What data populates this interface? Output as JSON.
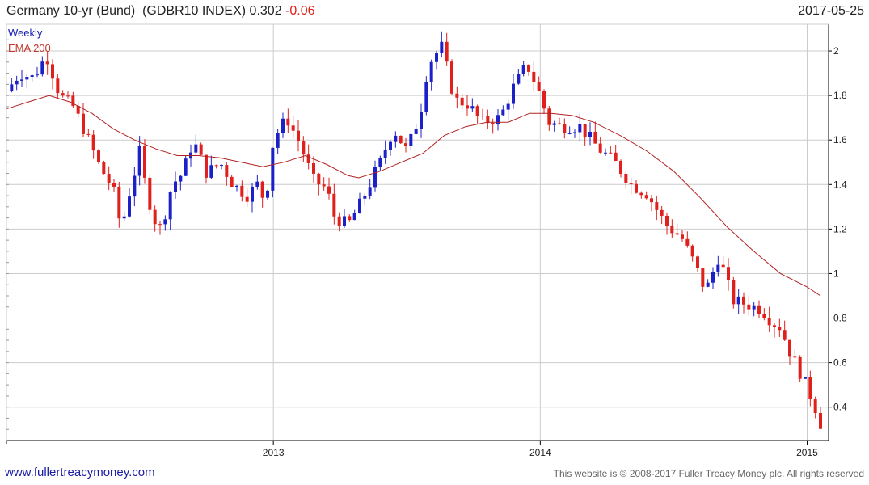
{
  "header": {
    "name": "Germany 10-yr (Bund)",
    "ticker": "(GDBR10 INDEX)",
    "last": "0.302",
    "change": "-0.06",
    "date": "2017-05-25"
  },
  "footer": {
    "site": "www.fullertreacymoney.com",
    "copyright": "This website is © 2008-2017 Fuller Treacy Money plc. All rights reserved"
  },
  "colors": {
    "up": "#1c20c8",
    "down": "#e0201c",
    "ema": "#b22222",
    "grid": "#cccccc",
    "axis": "#000000"
  },
  "chart_data": {
    "type": "candlestick",
    "legend": [
      "Weekly",
      "EMA 200"
    ],
    "legend_placement": "top-left",
    "y_axis_side": "right",
    "ylim": [
      0.25,
      2.12
    ],
    "yticks": [
      0.4,
      0.6,
      0.8,
      1,
      1.2,
      1.4,
      1.6,
      1.8,
      2
    ],
    "ytick_labels": [
      "0.4",
      "0.6",
      "0.8",
      "1",
      "1.2",
      "1.4",
      "1.6",
      "1.8",
      "2"
    ],
    "xlim": [
      2012.0,
      2015.05
    ],
    "xticks": [
      2013,
      2014,
      2015
    ],
    "xtick_labels": [
      "2013",
      "2014",
      "2015"
    ],
    "grid": true,
    "anchors": [
      [
        2012.0,
        1.82
      ],
      [
        2012.05,
        1.9
      ],
      [
        2012.1,
        1.88
      ],
      [
        2012.15,
        1.98
      ],
      [
        2012.2,
        1.8
      ],
      [
        2012.25,
        1.75
      ],
      [
        2012.3,
        1.62
      ],
      [
        2012.35,
        1.48
      ],
      [
        2012.4,
        1.38
      ],
      [
        2012.43,
        1.2
      ],
      [
        2012.46,
        1.36
      ],
      [
        2012.5,
        1.55
      ],
      [
        2012.52,
        1.4
      ],
      [
        2012.55,
        1.25
      ],
      [
        2012.58,
        1.2
      ],
      [
        2012.62,
        1.4
      ],
      [
        2012.66,
        1.45
      ],
      [
        2012.7,
        1.6
      ],
      [
        2012.75,
        1.45
      ],
      [
        2012.8,
        1.5
      ],
      [
        2012.85,
        1.4
      ],
      [
        2012.9,
        1.35
      ],
      [
        2012.94,
        1.4
      ],
      [
        2012.97,
        1.32
      ],
      [
        2013.0,
        1.6
      ],
      [
        2013.05,
        1.7
      ],
      [
        2013.1,
        1.58
      ],
      [
        2013.15,
        1.42
      ],
      [
        2013.2,
        1.38
      ],
      [
        2013.23,
        1.25
      ],
      [
        2013.28,
        1.22
      ],
      [
        2013.32,
        1.3
      ],
      [
        2013.36,
        1.4
      ],
      [
        2013.4,
        1.5
      ],
      [
        2013.45,
        1.65
      ],
      [
        2013.5,
        1.55
      ],
      [
        2013.55,
        1.72
      ],
      [
        2013.58,
        1.94
      ],
      [
        2013.63,
        2.02
      ],
      [
        2013.68,
        1.78
      ],
      [
        2013.73,
        1.76
      ],
      [
        2013.78,
        1.68
      ],
      [
        2013.85,
        1.7
      ],
      [
        2013.9,
        1.84
      ],
      [
        2013.95,
        1.94
      ],
      [
        2014.0,
        1.8
      ],
      [
        2014.03,
        1.68
      ],
      [
        2014.08,
        1.66
      ],
      [
        2014.15,
        1.66
      ],
      [
        2014.22,
        1.56
      ],
      [
        2014.28,
        1.5
      ],
      [
        2014.34,
        1.4
      ],
      [
        2014.4,
        1.36
      ],
      [
        2014.47,
        1.22
      ],
      [
        2014.53,
        1.16
      ],
      [
        2014.58,
        1.04
      ],
      [
        2014.62,
        0.92
      ],
      [
        2014.67,
        1.08
      ],
      [
        2014.72,
        0.88
      ],
      [
        2014.78,
        0.86
      ],
      [
        2014.83,
        0.84
      ],
      [
        2014.87,
        0.78
      ],
      [
        2014.9,
        0.76
      ],
      [
        2014.93,
        0.66
      ],
      [
        2014.98,
        0.54
      ],
      [
        2015.03,
        0.4
      ],
      [
        2015.05,
        0.31
      ]
    ],
    "ema_points": [
      [
        2012.0,
        1.74
      ],
      [
        2012.08,
        1.77
      ],
      [
        2012.16,
        1.8
      ],
      [
        2012.24,
        1.77
      ],
      [
        2012.32,
        1.72
      ],
      [
        2012.4,
        1.65
      ],
      [
        2012.48,
        1.6
      ],
      [
        2012.56,
        1.56
      ],
      [
        2012.64,
        1.53
      ],
      [
        2012.72,
        1.53
      ],
      [
        2012.8,
        1.52
      ],
      [
        2012.88,
        1.5
      ],
      [
        2012.96,
        1.48
      ],
      [
        2013.04,
        1.5
      ],
      [
        2013.12,
        1.53
      ],
      [
        2013.2,
        1.49
      ],
      [
        2013.28,
        1.44
      ],
      [
        2013.32,
        1.43
      ],
      [
        2013.4,
        1.46
      ],
      [
        2013.48,
        1.5
      ],
      [
        2013.56,
        1.54
      ],
      [
        2013.64,
        1.62
      ],
      [
        2013.72,
        1.66
      ],
      [
        2013.8,
        1.68
      ],
      [
        2013.88,
        1.68
      ],
      [
        2013.96,
        1.72
      ],
      [
        2014.04,
        1.72
      ],
      [
        2014.12,
        1.71
      ],
      [
        2014.2,
        1.68
      ],
      [
        2014.3,
        1.62
      ],
      [
        2014.4,
        1.55
      ],
      [
        2014.5,
        1.46
      ],
      [
        2014.6,
        1.34
      ],
      [
        2014.7,
        1.21
      ],
      [
        2014.8,
        1.1
      ],
      [
        2014.9,
        1.0
      ],
      [
        2015.0,
        0.94
      ],
      [
        2015.05,
        0.9
      ]
    ],
    "last_close": 0.302
  }
}
